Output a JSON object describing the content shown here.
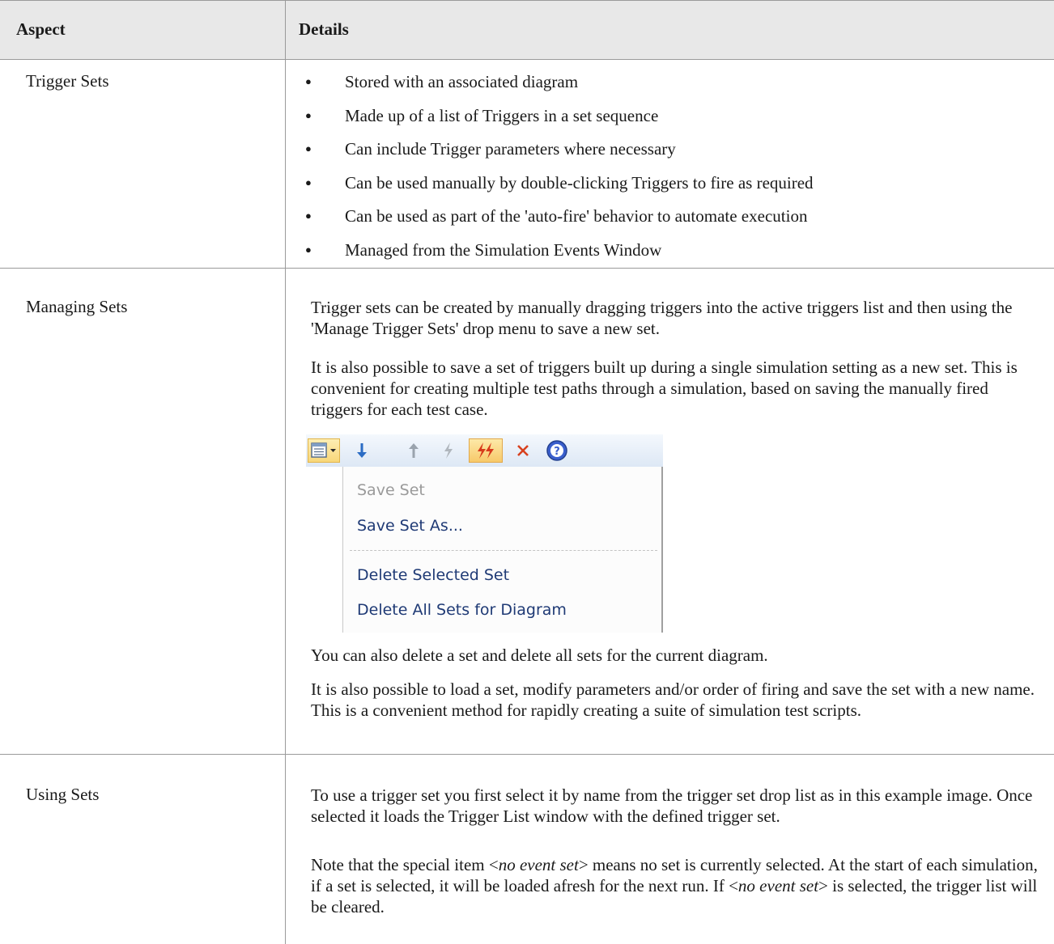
{
  "table": {
    "headers": {
      "aspect": "Aspect",
      "details": "Details"
    },
    "rows": [
      {
        "aspect": "Trigger Sets",
        "bullets": [
          "Stored with an associated diagram",
          "Made up of a list of Triggers in a set sequence",
          "Can include Trigger parameters where necessary",
          "Can be used manually by double-clicking Triggers to fire as required",
          "Can be used as part of the 'auto-fire' behavior to automate execution",
          "Managed from the Simulation Events Window"
        ]
      },
      {
        "aspect": "Managing Sets",
        "paragraphs": [
          "Trigger sets can be created by manually dragging triggers into the active triggers list and then using the 'Manage Trigger Sets' drop menu to save a new set.",
          "It is also possible to save a set of triggers built up during a single simulation setting as a new set. This is convenient for creating multiple test paths through a simulation, based on saving the manually fired triggers for each test case.",
          "You can also delete a set and delete all sets for the current diagram.",
          "It is also possible to load a set, modify parameters and/or order of firing and save the set with a new name. This is a convenient method for rapidly creating a suite of simulation test scripts."
        ],
        "screenshot": {
          "toolbar_icons": [
            "trigger-set-list-icon",
            "dropdown-arrow-icon",
            "move-down-icon",
            "move-up-icon",
            "fire-trigger-icon",
            "auto-fire-icon",
            "delete-icon",
            "help-icon"
          ],
          "menu": {
            "save_set": "Save Set",
            "save_set_as": "Save Set As...",
            "delete_selected_set": "Delete Selected Set",
            "delete_all_sets": "Delete All Sets for Diagram"
          }
        }
      },
      {
        "aspect": "Using Sets",
        "paragraphs": [
          "To use a trigger set you first select it by name from the trigger set drop list as in this example image. Once selected it loads the Trigger List window with the defined trigger set."
        ],
        "note": {
          "pre": "Note that the special item <",
          "em": "no event set",
          "post": "> means no set is currently selected. At the start of each simulation, if a set is selected, it will be loaded afresh for the next run. If <",
          "em2": "no event set",
          "post2": "> is selected, the trigger list will be cleared."
        }
      }
    ]
  },
  "colors": {
    "header_bg": "#e8e8e8",
    "rule": "#9a9a9a",
    "menu_text": "#1f3a75",
    "menu_disabled": "#9a9a9a",
    "auto_fire_red": "#d83a1a",
    "help_blue": "#3a5fcd"
  }
}
